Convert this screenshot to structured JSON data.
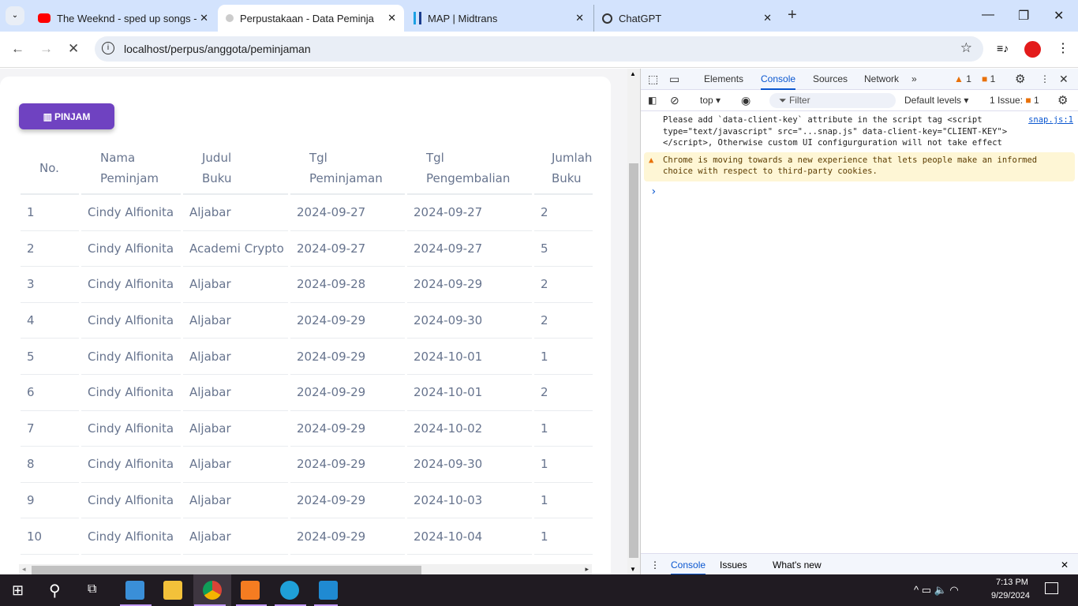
{
  "browser": {
    "tabs": [
      {
        "title": "The Weeknd - sped up songs - ",
        "icon": "youtube-icon"
      },
      {
        "title": "Perpustakaan - Data Peminjama",
        "icon": "site-icon",
        "active": true
      },
      {
        "title": "MAP | Midtrans",
        "icon": "midtrans-icon"
      },
      {
        "title": "ChatGPT",
        "icon": "chatgpt-icon"
      }
    ],
    "url": "localhost/perpus/anggota/peminjaman"
  },
  "page": {
    "pinjam_label": "PINJAM",
    "accent": "#6f42c1",
    "headers": [
      [
        "No.",
        ""
      ],
      [
        "Nama",
        "Peminjam"
      ],
      [
        "Judul",
        "Buku"
      ],
      [
        "Tgl",
        "Peminjaman"
      ],
      [
        "Tgl",
        "Pengembalian"
      ],
      [
        "Jumlah",
        "Buku"
      ]
    ],
    "rows": [
      [
        "1",
        "Cindy Alfionita",
        "Aljabar",
        "2024-09-27",
        "2024-09-27",
        "2"
      ],
      [
        "2",
        "Cindy Alfionita",
        "Academi Crypto",
        "2024-09-27",
        "2024-09-27",
        "5"
      ],
      [
        "3",
        "Cindy Alfionita",
        "Aljabar",
        "2024-09-28",
        "2024-09-29",
        "2"
      ],
      [
        "4",
        "Cindy Alfionita",
        "Aljabar",
        "2024-09-29",
        "2024-09-30",
        "2"
      ],
      [
        "5",
        "Cindy Alfionita",
        "Aljabar",
        "2024-09-29",
        "2024-10-01",
        "1"
      ],
      [
        "6",
        "Cindy Alfionita",
        "Aljabar",
        "2024-09-29",
        "2024-10-01",
        "2"
      ],
      [
        "7",
        "Cindy Alfionita",
        "Aljabar",
        "2024-09-29",
        "2024-10-02",
        "1"
      ],
      [
        "8",
        "Cindy Alfionita",
        "Aljabar",
        "2024-09-29",
        "2024-09-30",
        "1"
      ],
      [
        "9",
        "Cindy Alfionita",
        "Aljabar",
        "2024-09-29",
        "2024-10-03",
        "1"
      ],
      [
        "10",
        "Cindy Alfionita",
        "Aljabar",
        "2024-09-29",
        "2024-10-04",
        "1"
      ]
    ]
  },
  "devtools": {
    "tabs": [
      "Elements",
      "Console",
      "Sources",
      "Network"
    ],
    "warn_count": "1",
    "error_count": "1",
    "context": "top",
    "filter_placeholder": "Filter",
    "levels": "Default levels",
    "issues": "1 Issue:",
    "issues_count": "1",
    "messages": [
      {
        "text": "Please add `data-client-key` attribute in the script tag <script type=\"text/javascript\" src=\"...snap.js\" data-client-key=\"CLIENT-KEY\"></script>, Otherwise custom UI configurguration will not take effect",
        "source": "snap.js:1"
      },
      {
        "text": "Chrome is moving towards a new experience that lets people make an informed choice with respect to third-party cookies.",
        "level": "warning"
      }
    ],
    "prompt": "›",
    "drawer_tabs": [
      "Console",
      "Issues",
      "What's new"
    ]
  },
  "taskbar": {
    "time": "7:13 PM",
    "date": "9/29/2024"
  }
}
